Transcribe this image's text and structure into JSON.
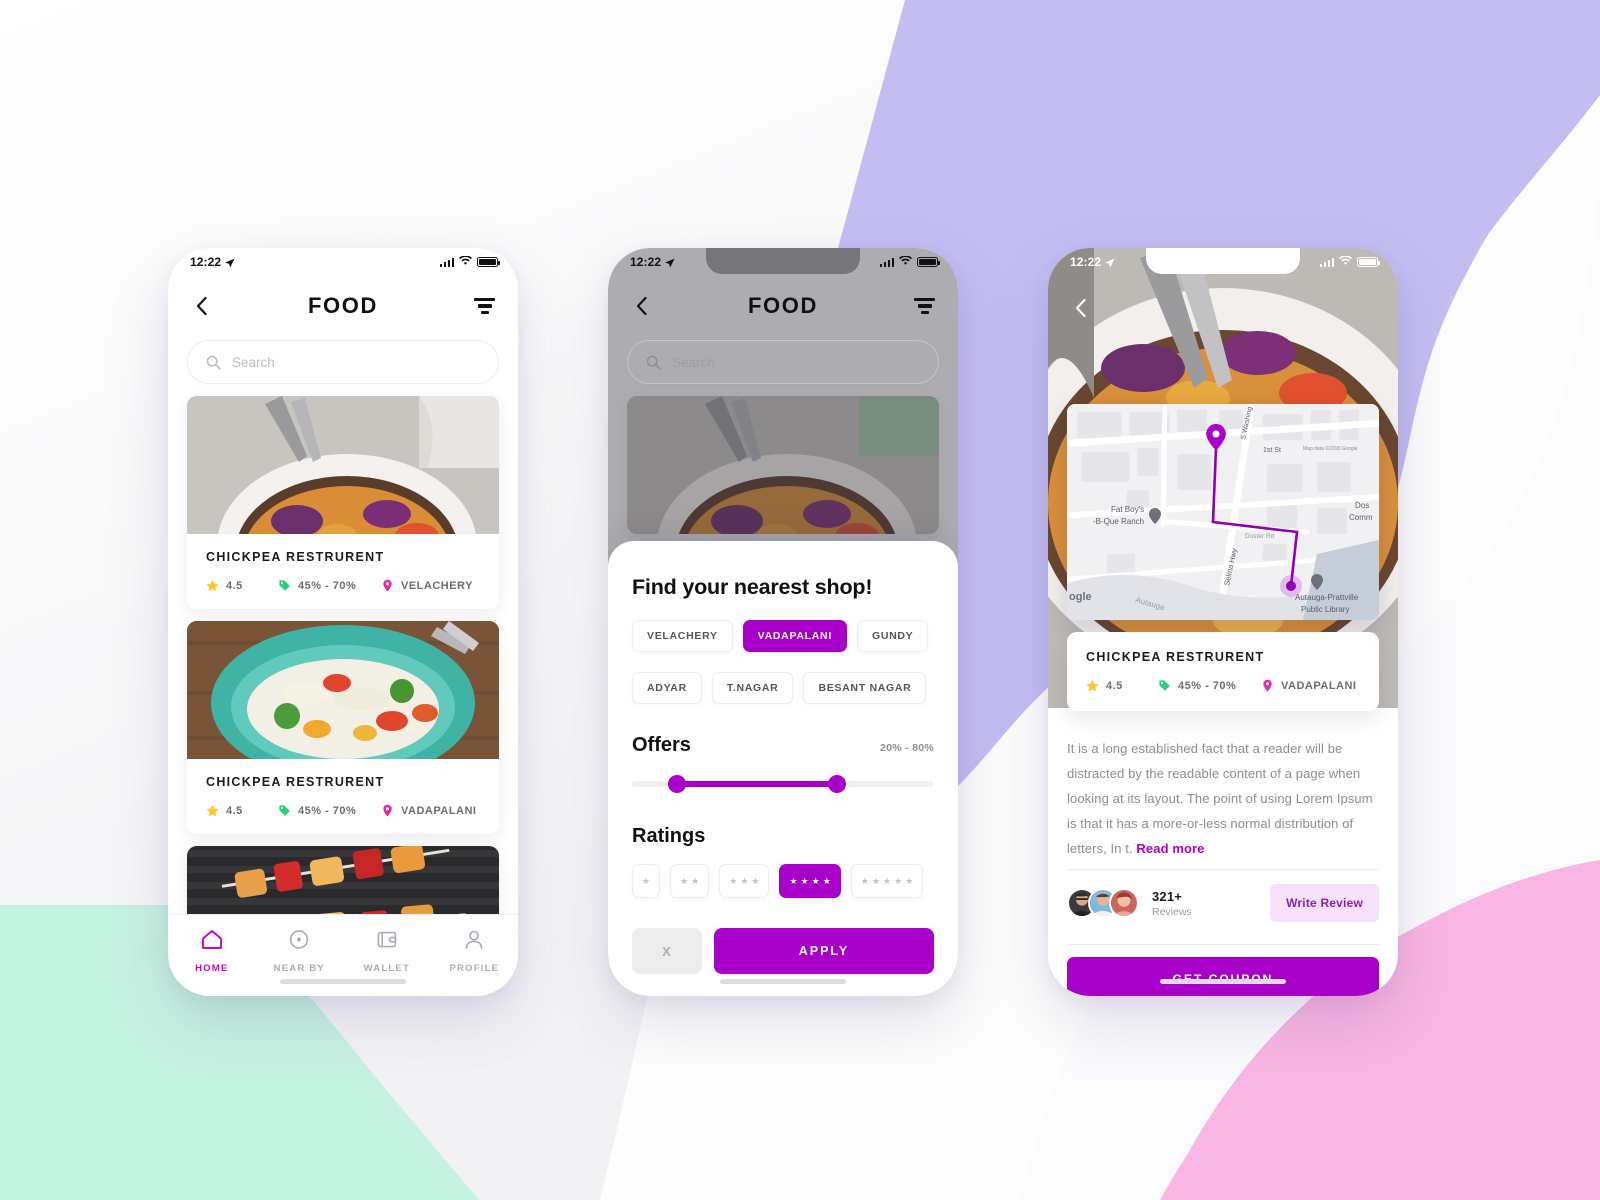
{
  "palette": {
    "accent_purple": "#a800c8",
    "magenta": "#cc00cc",
    "lavender_blob": "#c3bdf2",
    "mint_blob": "#c6f2e2",
    "pink_blob": "#f9b5e3",
    "star_yellow": "#ffc62e",
    "tag_green": "#27d17c",
    "pin_pink": "#ef1fa0"
  },
  "phone1": {
    "status": {
      "time": "12:22",
      "location_icon": "location-arrow-icon",
      "signal_icon": "signal-bars-icon",
      "wifi_icon": "wifi-icon",
      "battery_icon": "battery-icon"
    },
    "header": {
      "back_icon": "chevron-left-icon",
      "title": "FOOD",
      "filter_icon": "filter-icon"
    },
    "search": {
      "placeholder": "Search",
      "icon": "search-icon",
      "value": ""
    },
    "cards": [
      {
        "name": "CHICKPEA RESTRURENT",
        "rating": "4.5",
        "offer": "45% - 70%",
        "location": "VELACHERY",
        "photo": "chickpea-bowl-photo"
      },
      {
        "name": "CHICKPEA RESTRURENT",
        "rating": "4.5",
        "offer": "45% - 70%",
        "location": "VADAPALANI",
        "photo": "noodle-bowl-photo"
      },
      {
        "name": "",
        "rating": "",
        "offer": "",
        "location": "",
        "photo": "grilled-skewers-photo"
      }
    ],
    "tabs": [
      {
        "label": "HOME",
        "icon": "home-icon",
        "active": true
      },
      {
        "label": "NEAR BY",
        "icon": "compass-icon",
        "active": false
      },
      {
        "label": "WALLET",
        "icon": "wallet-icon",
        "active": false
      },
      {
        "label": "PROFILE",
        "icon": "person-icon",
        "active": false
      }
    ]
  },
  "phone2": {
    "status": {
      "time": "12:22"
    },
    "header": {
      "title": "FOOD",
      "back_icon": "chevron-left-icon",
      "filter_icon": "filter-icon"
    },
    "search": {
      "placeholder": "Search",
      "value": ""
    },
    "sheet": {
      "title": "Find your nearest shop!",
      "chips_row1": [
        {
          "label": "VELACHERY",
          "selected": false
        },
        {
          "label": "VADAPALANI",
          "selected": true
        },
        {
          "label": "GUNDY",
          "selected": false
        }
      ],
      "chips_row2": [
        {
          "label": "ADYAR",
          "selected": false
        },
        {
          "label": "T.NAGAR",
          "selected": false
        },
        {
          "label": "BESANT NAGAR",
          "selected": false
        }
      ],
      "offers": {
        "title": "Offers",
        "range_label": "20% - 80%",
        "min_pct": 20,
        "max_pct": 80
      },
      "ratings": {
        "title": "Ratings",
        "options": [
          {
            "stars": 1,
            "selected": false
          },
          {
            "stars": 2,
            "selected": false
          },
          {
            "stars": 3,
            "selected": false
          },
          {
            "stars": 4,
            "selected": true
          },
          {
            "stars": 5,
            "selected": false
          }
        ]
      },
      "clear_label": "X",
      "apply_label": "APPLY"
    }
  },
  "phone3": {
    "status": {
      "time": "12:22"
    },
    "back_icon": "chevron-left-icon",
    "map": {
      "pin_start_icon": "map-pin-icon",
      "pin_end_icon": "map-destination-icon",
      "labels": [
        "S Washington",
        "1st St",
        "Fat Boy's",
        "B-Que Ranch",
        "Selma Hwy",
        "Doster Rd",
        "Autauga Cr",
        "Autauga-Prattville",
        "Public Library",
        "Doster",
        "Community",
        "ogle",
        "Map data ©2018 Google"
      ]
    },
    "detail": {
      "name": "CHICKPEA RESTRURENT",
      "rating": "4.5",
      "offer": "45% - 70%",
      "location": "VADAPALANI"
    },
    "description": "It is a long established fact that a reader will be distracted by the readable content of a page when looking at its layout. The point of using Lorem Ipsum is that it has a more-or-less normal distribution of letters, In t.",
    "read_more_label": "Read more",
    "reviews": {
      "count": "321+",
      "label": "Reviews",
      "avatars": [
        "reviewer-avatar-1",
        "reviewer-avatar-2",
        "reviewer-avatar-3"
      ]
    },
    "write_review_label": "Write Review",
    "get_coupon_label": "GET COUPON"
  }
}
